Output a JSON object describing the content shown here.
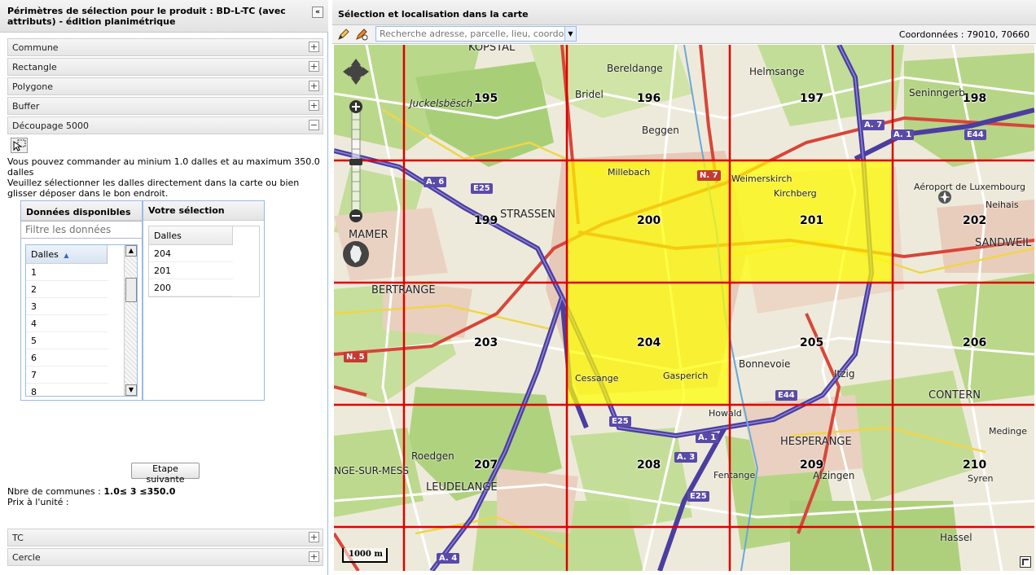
{
  "left_panel": {
    "title": "Périmètres de sélection pour le produit : BD-L-TC (avec attributs) - édition planimétrique",
    "collapse_icon": "«",
    "accordion": [
      {
        "label": "Commune",
        "state": "+"
      },
      {
        "label": "Rectangle",
        "state": "+"
      },
      {
        "label": "Polygone",
        "state": "+"
      },
      {
        "label": "Buffer",
        "state": "+"
      },
      {
        "label": "Découpage 5000",
        "state": "−"
      }
    ],
    "accordion_bottom": [
      {
        "label": "TC",
        "state": "+"
      },
      {
        "label": "Cercle",
        "state": "+"
      }
    ],
    "info_line1": "Vous pouvez commander au minium 1.0 dalles et au maximum 350.0 dalles",
    "info_line2": "Veuillez sélectionner les dalles directement dans la carte ou bien glisser déposer dans le bon endroit.",
    "available": {
      "title": "Données disponibles",
      "filter_placeholder": "Filtre les données",
      "column": "Dalles",
      "sort_icon": "▲",
      "rows": [
        "1",
        "2",
        "3",
        "4",
        "5",
        "6",
        "7",
        "8"
      ]
    },
    "selection": {
      "title": "Votre sélection",
      "column": "Dalles",
      "rows": [
        "204",
        "201",
        "200"
      ]
    },
    "next_button": "Etape suivante",
    "communes_label": "Nbre de communes :",
    "communes_value": "1.0≤ 3 ≤350.0",
    "unit_price_label": "Prix à l'unité :"
  },
  "map_panel": {
    "title": "Sélection et localisation dans la carte",
    "search_placeholder": "Recherche adresse, parcelle, lieu, coordonnÃ©",
    "coordinates_label": "Coordonnées :",
    "coordinates_value": "79010, 70660",
    "scale_label": "1000 m",
    "tiles": [
      "195",
      "196",
      "197",
      "198",
      "199",
      "200",
      "201",
      "202",
      "203",
      "204",
      "205",
      "206",
      "207",
      "208",
      "209",
      "210"
    ],
    "selected_tiles": [
      "200",
      "201",
      "204"
    ],
    "places": [
      "KOPSTAL",
      "Bereldange",
      "Helmsange",
      "Seninngerb.",
      "Juckelsbësch",
      "Bridel",
      "Beggen",
      "Millebach",
      "Weimerskirch",
      "Kirchberg",
      "Aéroport de Luxembourg",
      "Neihais",
      "STRASSEN",
      "MAMER",
      "SANDWEIL",
      "BERTRANGE",
      "Bonnevoie",
      "CONTERN",
      "Itzig",
      "HESPERANGE",
      "Alzingen",
      "LEUDELANGE",
      "Roedgen",
      "NGE-SUR-MESS",
      "Fentange",
      "Syren",
      "Hassel",
      "Cessange",
      "Gasperich",
      "Howald",
      "Medinge"
    ],
    "colors": {
      "selection": "#ffff00",
      "grid": "#dd0000",
      "motorway": "#4b3ea0"
    }
  }
}
